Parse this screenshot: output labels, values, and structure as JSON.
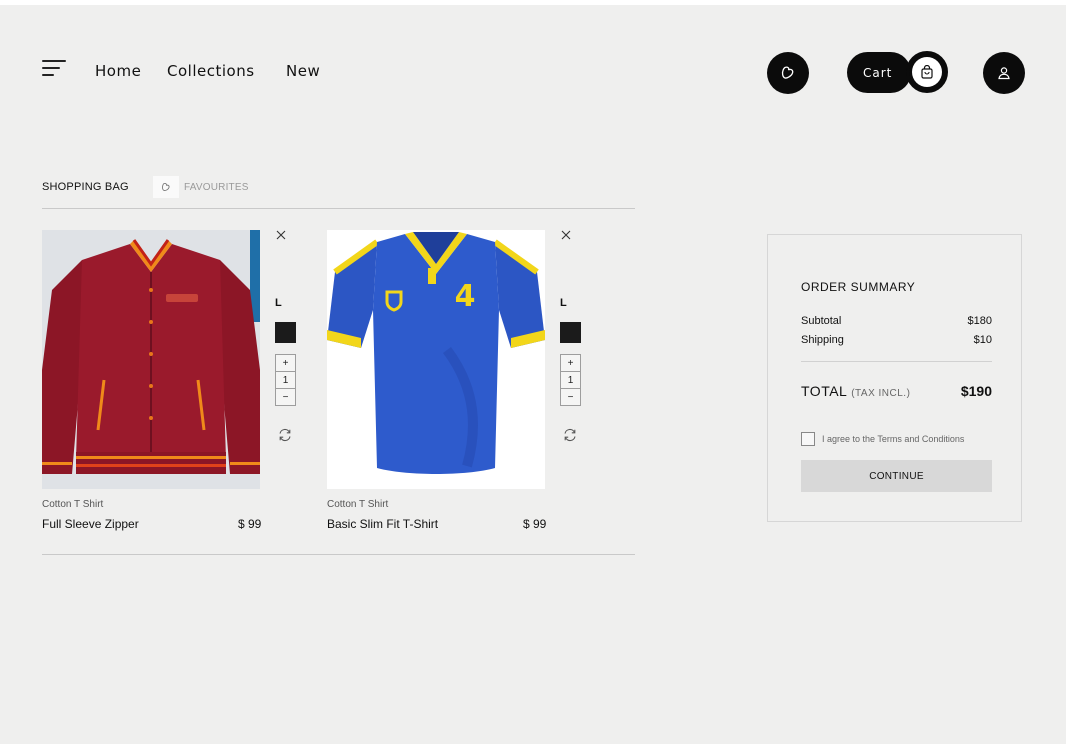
{
  "nav": {
    "links": [
      "Home",
      "Collections",
      "New"
    ],
    "cart_label": "Cart"
  },
  "tabs": {
    "bag": "SHOPPING BAG",
    "favourites": "FAVOURITES"
  },
  "products": [
    {
      "category": "Cotton T Shirt",
      "name": "Full Sleeve Zipper",
      "price": "$ 99",
      "size": "L",
      "quantity": "1",
      "image_icon": "red-varsity-jacket-image"
    },
    {
      "category": "Cotton T Shirt",
      "name": "Basic Slim Fit T-Shirt",
      "price": "$ 99",
      "size": "L",
      "quantity": "1",
      "image_icon": "blue-jersey-image"
    }
  ],
  "stepper": {
    "plus": "+",
    "minus": "−"
  },
  "summary": {
    "title": "ORDER SUMMARY",
    "subtotal_label": "Subtotal",
    "subtotal_value": "$180",
    "shipping_label": "Shipping",
    "shipping_value": "$10",
    "total_label": "TOTAL",
    "total_note": "(TAX INCL.)",
    "total_value": "$190",
    "agree_label": "I agree to the Terms and Conditions",
    "continue_label": "CONTINUE"
  },
  "colors": {
    "background": "#efefee",
    "primary": "#0b0b0b",
    "swatch": "#1b1b1b",
    "button_bg": "#d8d8d8"
  }
}
